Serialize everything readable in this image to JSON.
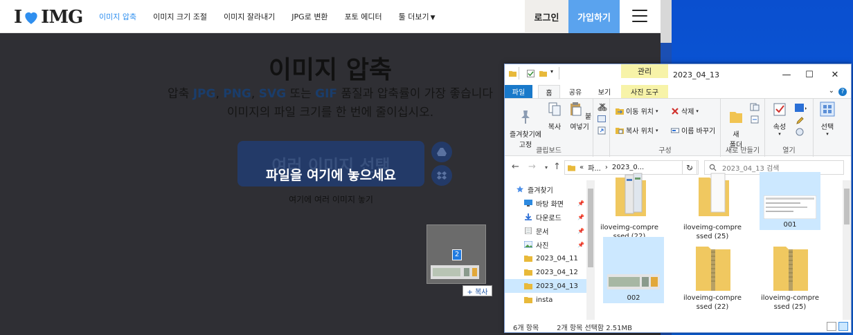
{
  "web": {
    "logo": {
      "left": "I",
      "right": "IMG"
    },
    "nav": [
      {
        "label": "이미지 압축",
        "active": true
      },
      {
        "label": "이미지 크기 조절",
        "active": false
      },
      {
        "label": "이미지 잘라내기",
        "active": false
      },
      {
        "label": "JPG로 변환",
        "active": false
      },
      {
        "label": "포토 에디터",
        "active": false
      },
      {
        "label": "툴 더보기",
        "active": false
      }
    ],
    "login_label": "로그인",
    "signup_label": "가입하기",
    "title": "이미지 압축",
    "subtitle": {
      "pre": "압축 ",
      "fmt1": "JPG",
      "sep1": ", ",
      "fmt2": "PNG",
      "sep2": ", ",
      "fmt3": "SVG",
      "mid": " 또는 ",
      "fmt4": "GIF",
      "post": " 품질과 압축률이 가장 좋습니다",
      "line2": "이미지의 파일 크기를 한 번에 줄이십시오."
    },
    "select_button": "여러 이미지 선택",
    "drop_overlay": "파일을 여기에 놓으세요",
    "drop_hint": "여기에 여러 이미지 놓기",
    "drag": {
      "count": "2",
      "copy_tip": "+ 복사"
    }
  },
  "explorer": {
    "context_tab": "관리",
    "title": "2023_04_13",
    "tabs": {
      "file": "파일",
      "home": "홈",
      "share": "공유",
      "view": "보기",
      "tools": "사진 도구"
    },
    "ribbon": {
      "pin": "즐겨찾기에\n고정",
      "copy": "복사",
      "paste": "붙여넣기",
      "clipboard": "클립보드",
      "move_to": "이동 위치",
      "delete": "삭제",
      "copy_to": "복사 위치",
      "rename": "이름 바꾸기",
      "organize": "구성",
      "new_folder": "새\n폴더",
      "new": "새로 만들기",
      "properties": "속성",
      "open": "열기",
      "select": "선택"
    },
    "address": {
      "path_prefix": "«",
      "part1": "파...",
      "part2": "2023_0...",
      "search_placeholder": "2023_04_13 검색"
    },
    "nav_items": [
      {
        "label": "즐겨찾기",
        "icon": "star-icon",
        "pinned": false,
        "selected": false
      },
      {
        "label": "바탕 화면",
        "icon": "desktop-icon",
        "pinned": true,
        "selected": false
      },
      {
        "label": "다운로드",
        "icon": "download-icon",
        "pinned": true,
        "selected": false
      },
      {
        "label": "문서",
        "icon": "document-icon",
        "pinned": true,
        "selected": false
      },
      {
        "label": "사진",
        "icon": "pictures-icon",
        "pinned": true,
        "selected": false
      },
      {
        "label": "2023_04_11",
        "icon": "folder-icon",
        "pinned": false,
        "selected": false
      },
      {
        "label": "2023_04_12",
        "icon": "folder-icon",
        "pinned": false,
        "selected": false
      },
      {
        "label": "2023_04_13",
        "icon": "folder-icon",
        "pinned": false,
        "selected": true
      },
      {
        "label": "insta",
        "icon": "folder-icon",
        "pinned": false,
        "selected": false
      }
    ],
    "files": [
      {
        "name": "iloveimg-compressed (22)",
        "line1": "iloveimg-compre",
        "line2": "ssed (22)",
        "kind": "folder-preview",
        "selected": false
      },
      {
        "name": "iloveimg-compressed (25)",
        "line1": "iloveimg-compre",
        "line2": "ssed (25)",
        "kind": "folder-doc",
        "selected": false
      },
      {
        "name": "001",
        "line1": "001",
        "line2": "",
        "kind": "image",
        "selected": true
      },
      {
        "name": "002",
        "line1": "002",
        "line2": "",
        "kind": "image2",
        "selected": true
      },
      {
        "name": "iloveimg-compressed (22)",
        "line1": "iloveimg-compre",
        "line2": "ssed (22)",
        "kind": "zip",
        "selected": false
      },
      {
        "name": "iloveimg-compressed (25)",
        "line1": "iloveimg-compre",
        "line2": "ssed (25)",
        "kind": "zip",
        "selected": false
      }
    ],
    "status": {
      "count": "6개 항목",
      "selection": "2개 항목 선택함 2.51MB"
    }
  }
}
